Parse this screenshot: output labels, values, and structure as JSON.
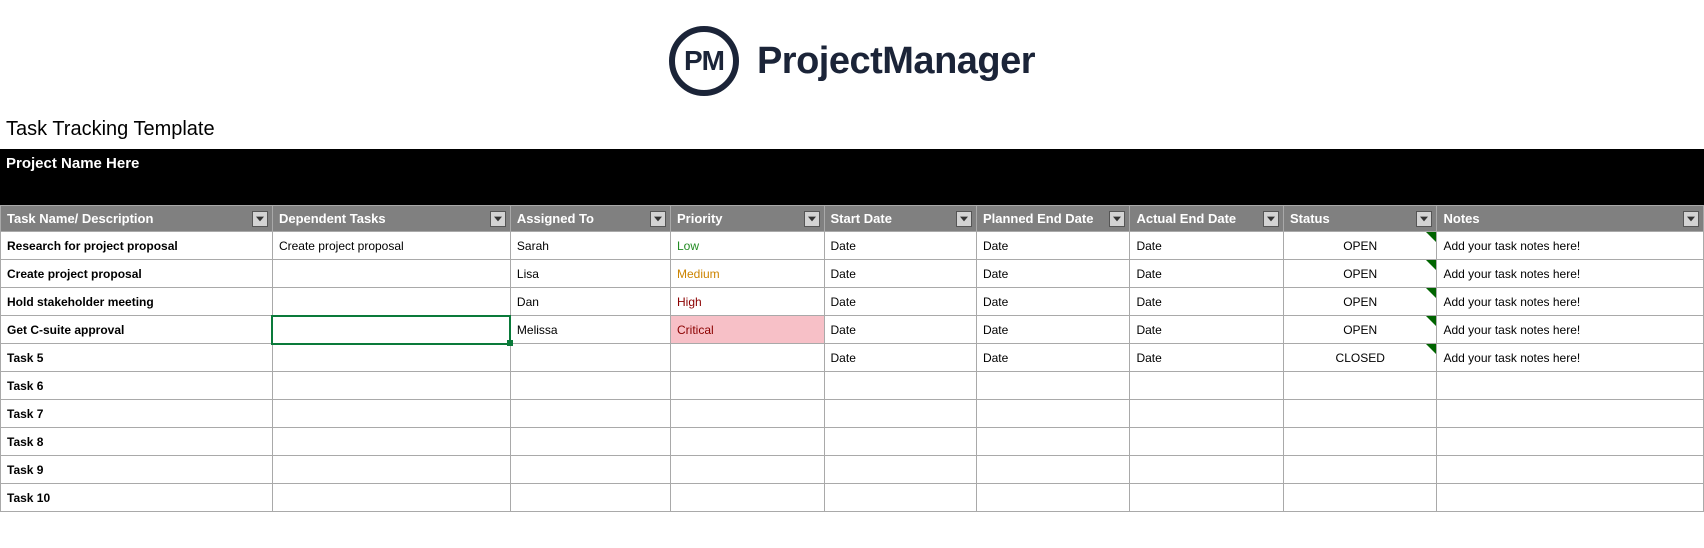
{
  "brand": {
    "mark": "PM",
    "name": "ProjectManager"
  },
  "template_title": "Task Tracking Template",
  "project_name": "Project Name Here",
  "columns": {
    "task": "Task Name/ Description",
    "dep": "Dependent Tasks",
    "asg": "Assigned To",
    "pri": "Priority",
    "start": "Start Date",
    "pend": "Planned End Date",
    "aend": "Actual End Date",
    "status": "Status",
    "notes": "Notes"
  },
  "rows": [
    {
      "task": "Research for project proposal",
      "dep": "Create project proposal",
      "asg": "Sarah",
      "pri": "Low",
      "pri_class": "pri-low",
      "start": "Date",
      "pend": "Date",
      "aend": "Date",
      "status": "OPEN",
      "notes": "Add your task notes here!"
    },
    {
      "task": "Create project proposal",
      "dep": "",
      "asg": "Lisa",
      "pri": "Medium",
      "pri_class": "pri-med",
      "start": "Date",
      "pend": "Date",
      "aend": "Date",
      "status": "OPEN",
      "notes": "Add your task notes here!"
    },
    {
      "task": "Hold stakeholder meeting",
      "dep": "",
      "asg": "Dan",
      "pri": "High",
      "pri_class": "pri-high",
      "start": "Date",
      "pend": "Date",
      "aend": "Date",
      "status": "OPEN",
      "notes": "Add your task notes here!"
    },
    {
      "task": "Get C-suite approval",
      "dep": "",
      "asg": "Melissa",
      "pri": "Critical",
      "pri_class": "pri-crit",
      "start": "Date",
      "pend": "Date",
      "aend": "Date",
      "status": "OPEN",
      "notes": "Add your task notes here!",
      "selected_dep": true
    },
    {
      "task": "Task 5",
      "dep": "",
      "asg": "",
      "pri": "",
      "pri_class": "",
      "start": "Date",
      "pend": "Date",
      "aend": "Date",
      "status": "CLOSED",
      "notes": "Add your task notes here!"
    },
    {
      "task": "Task 6",
      "dep": "",
      "asg": "",
      "pri": "",
      "pri_class": "",
      "start": "",
      "pend": "",
      "aend": "",
      "status": "",
      "notes": ""
    },
    {
      "task": "Task 7",
      "dep": "",
      "asg": "",
      "pri": "",
      "pri_class": "",
      "start": "",
      "pend": "",
      "aend": "",
      "status": "",
      "notes": ""
    },
    {
      "task": "Task 8",
      "dep": "",
      "asg": "",
      "pri": "",
      "pri_class": "",
      "start": "",
      "pend": "",
      "aend": "",
      "status": "",
      "notes": ""
    },
    {
      "task": "Task 9",
      "dep": "",
      "asg": "",
      "pri": "",
      "pri_class": "",
      "start": "",
      "pend": "",
      "aend": "",
      "status": "",
      "notes": ""
    },
    {
      "task": "Task 10",
      "dep": "",
      "asg": "",
      "pri": "",
      "pri_class": "",
      "start": "",
      "pend": "",
      "aend": "",
      "status": "",
      "notes": ""
    }
  ]
}
